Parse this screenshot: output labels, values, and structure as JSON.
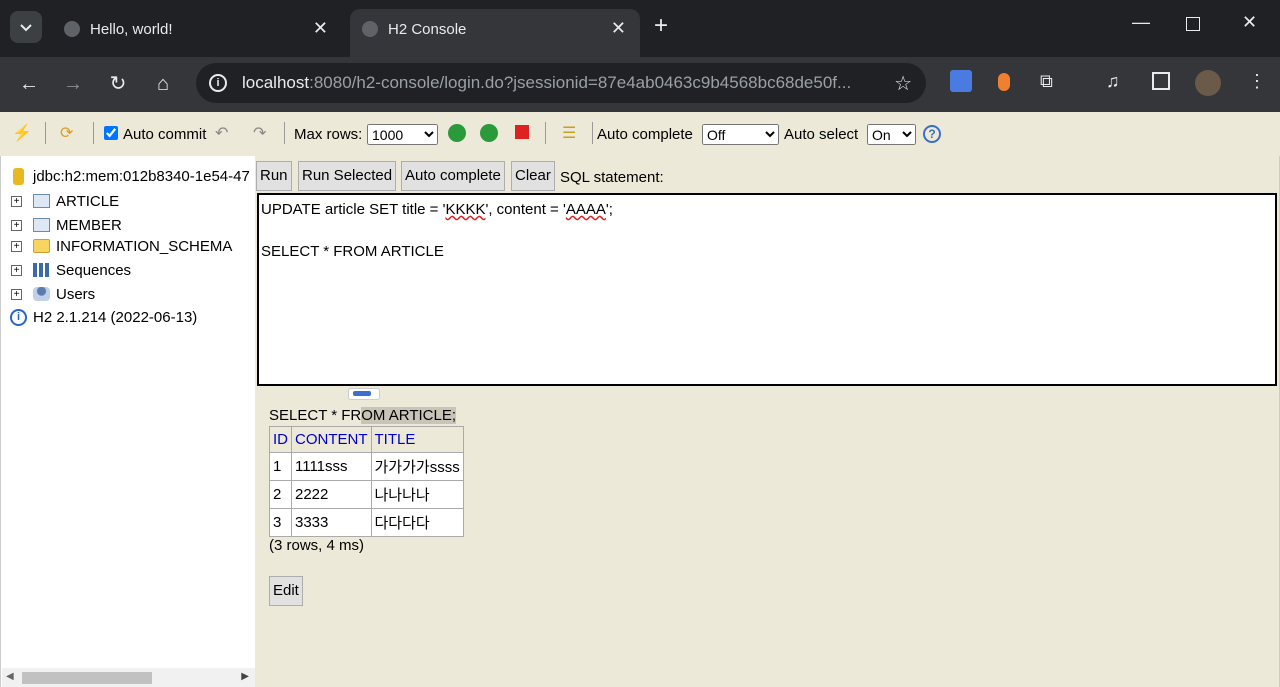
{
  "browser": {
    "tabs": [
      {
        "title": "Hello, world!",
        "active": false
      },
      {
        "title": "H2 Console",
        "active": true
      }
    ],
    "url_host": "localhost",
    "url_rest": ":8080/h2-console/login.do?jsessionid=87e4ab0463c9b4568bc68de50f..."
  },
  "h2toolbar": {
    "auto_commit_label": "Auto commit",
    "max_rows_label": "Max rows:",
    "max_rows_value": "1000",
    "auto_complete_label": "Auto complete",
    "auto_complete_value": "Off",
    "auto_select_label": "Auto select",
    "auto_select_value": "On"
  },
  "tree": {
    "connection": "jdbc:h2:mem:012b8340-1e54-47",
    "items": [
      {
        "label": "ARTICLE"
      },
      {
        "label": "MEMBER"
      },
      {
        "label": "INFORMATION_SCHEMA"
      },
      {
        "label": "Sequences"
      },
      {
        "label": "Users"
      }
    ],
    "version": "H2 2.1.214 (2022-06-13)"
  },
  "query": {
    "buttons": {
      "run": "Run",
      "run_selected": "Run Selected",
      "auto_complete": "Auto complete",
      "clear": "Clear"
    },
    "sql_label": "SQL statement:",
    "line1_a": "UPDATE article SET title = '",
    "line1_b": "KKKK",
    "line1_c": "', content = '",
    "line1_d": "AAAA",
    "line1_e": "';",
    "line3": "SELECT * FROM ARTICLE"
  },
  "result": {
    "stmt_a": "SELECT * FR",
    "stmt_b": "OM ARTICLE;",
    "headers": [
      "ID",
      "CONTENT",
      "TITLE"
    ],
    "rows": [
      [
        "1",
        "1111sss",
        "가가가가ssss"
      ],
      [
        "2",
        "2222",
        "나나나나"
      ],
      [
        "3",
        "3333",
        "다다다다"
      ]
    ],
    "row_count": "(3 rows, 4 ms)",
    "edit_label": "Edit"
  }
}
